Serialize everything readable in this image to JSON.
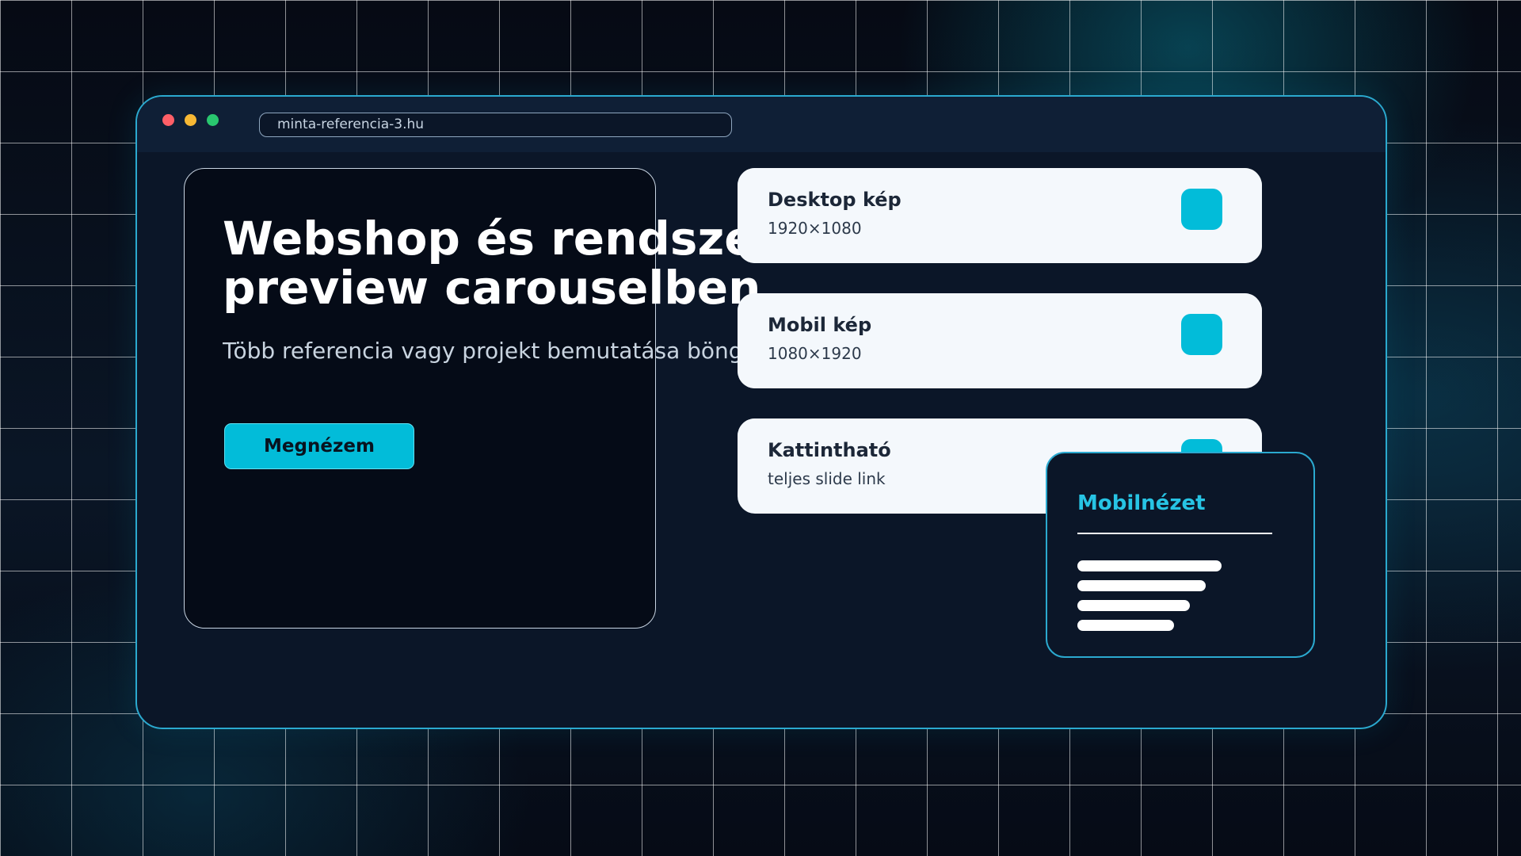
{
  "browser": {
    "url": "minta-referencia-3.hu"
  },
  "hero": {
    "title": "Webshop és rendszer\npreview carouselben",
    "subtitle": "Több referencia vagy projekt bemutatása böngésző mockupban",
    "cta_label": "Megnézem"
  },
  "cards": [
    {
      "title": "Desktop kép",
      "meta": "1920×1080"
    },
    {
      "title": "Mobil kép",
      "meta": "1080×1920"
    },
    {
      "title": "Kattintható",
      "meta": "teljes slide link"
    }
  ],
  "mobile_panel": {
    "title": "Mobilnézet"
  },
  "colors": {
    "accent": "#02bcd9",
    "frame": "#2ba9cf",
    "card_bg": "#f4f8fc"
  }
}
